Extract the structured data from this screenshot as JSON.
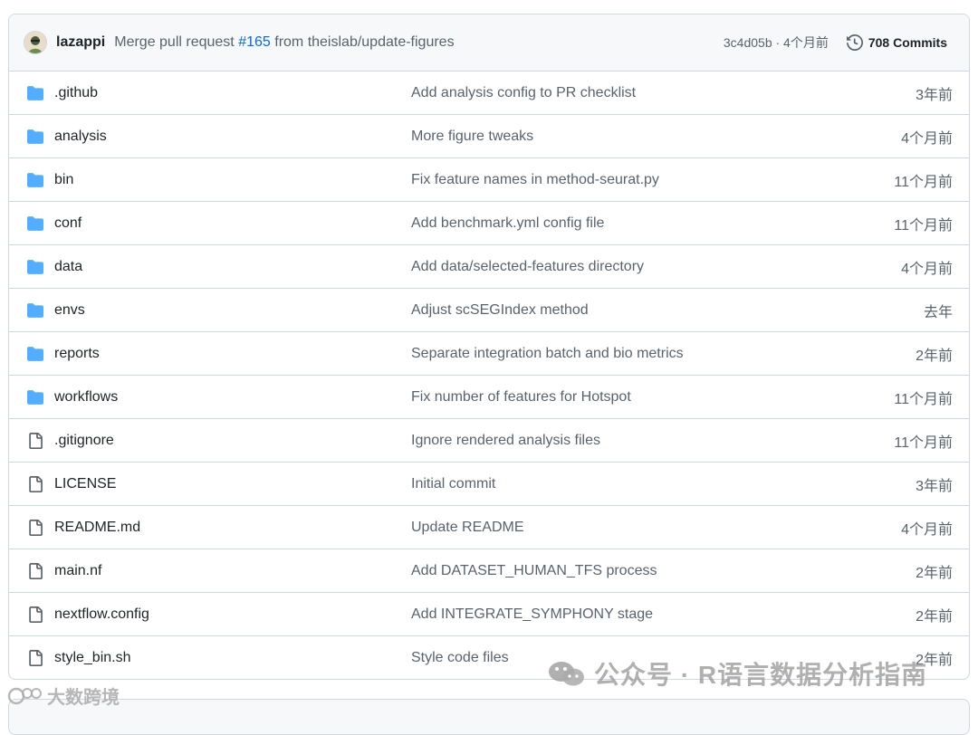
{
  "commit_header": {
    "author": "lazappi",
    "message_prefix": "Merge pull request ",
    "pr_link": "#165",
    "message_suffix": " from theislab/update-figures",
    "sha_and_time": "3c4d05b · 4个月前",
    "commits_label": "708 Commits"
  },
  "files": [
    {
      "type": "folder",
      "name": ".github",
      "message": "Add analysis config to PR checklist",
      "age": "3年前"
    },
    {
      "type": "folder",
      "name": "analysis",
      "message": "More figure tweaks",
      "age": "4个月前"
    },
    {
      "type": "folder",
      "name": "bin",
      "message": "Fix feature names in method-seurat.py",
      "age": "11个月前"
    },
    {
      "type": "folder",
      "name": "conf",
      "message": "Add benchmark.yml config file",
      "age": "11个月前"
    },
    {
      "type": "folder",
      "name": "data",
      "message": "Add data/selected-features directory",
      "age": "4个月前"
    },
    {
      "type": "folder",
      "name": "envs",
      "message": "Adjust scSEGIndex method",
      "age": "去年"
    },
    {
      "type": "folder",
      "name": "reports",
      "message": "Separate integration batch and bio metrics",
      "age": "2年前"
    },
    {
      "type": "folder",
      "name": "workflows",
      "message": "Fix number of features for Hotspot",
      "age": "11个月前"
    },
    {
      "type": "file",
      "name": ".gitignore",
      "message": "Ignore rendered analysis files",
      "age": "11个月前"
    },
    {
      "type": "file",
      "name": "LICENSE",
      "message": "Initial commit",
      "age": "3年前"
    },
    {
      "type": "file",
      "name": "README.md",
      "message": "Update README",
      "age": "4个月前"
    },
    {
      "type": "file",
      "name": "main.nf",
      "message": "Add DATASET_HUMAN_TFS process",
      "age": "2年前"
    },
    {
      "type": "file",
      "name": "nextflow.config",
      "message": "Add INTEGRATE_SYMPHONY stage",
      "age": "2年前"
    },
    {
      "type": "file",
      "name": "style_bin.sh",
      "message": "Style code files",
      "age": "2年前"
    }
  ],
  "watermarks": {
    "wechat": "公众号 · R语言数据分析指南",
    "corner": "大数跨境"
  },
  "colors": {
    "folder": "#54aeff",
    "file_icon": "#59636e",
    "link": "#0969da"
  }
}
